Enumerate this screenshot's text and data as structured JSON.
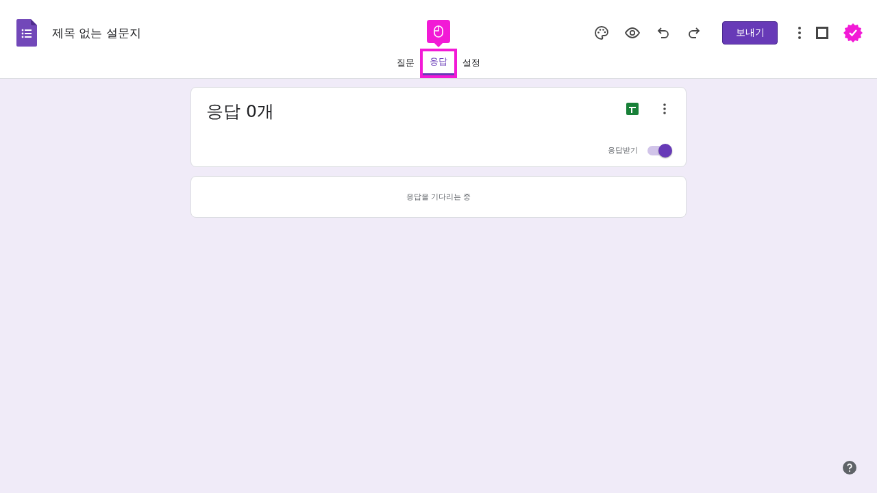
{
  "header": {
    "title": "제목 없는 설문지",
    "send_button": "보내기"
  },
  "tabs": [
    {
      "label": "질문",
      "selected": false
    },
    {
      "label": "응답",
      "selected": true,
      "highlighted": true
    },
    {
      "label": "설정",
      "selected": false
    }
  ],
  "summary": {
    "title": "응답 0개",
    "accepting_label": "응답받기",
    "accepting": true
  },
  "empty_message": "응답을 기다리는 중"
}
